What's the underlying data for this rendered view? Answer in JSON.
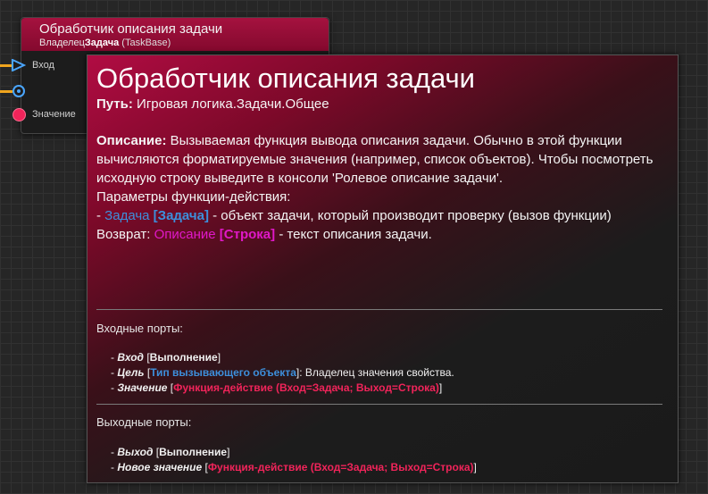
{
  "node": {
    "title": "Обработчик описания задачи",
    "subtitle_prefix": "Владелец",
    "subtitle_bold": "Задача",
    "subtitle_suffix": "(TaskBase)",
    "ports": {
      "exec_in_label": "Вход",
      "value_label": "Значение"
    },
    "colors": {
      "header": "#a5123f",
      "exec_pin": "#4aa6ff",
      "wire": "#f0a51e",
      "value_pin": "#f0245a"
    }
  },
  "tooltip": {
    "title": "Обработчик описания задачи",
    "path_label": "Путь:",
    "path_value": "Игровая логика.Задачи.Общее",
    "description_label": "Описание:",
    "description_text": "Вызываемая функция вывода описания задачи. Обычно в этой функции вычисляются форматируемые значения (например, список объектов). Чтобы посмотреть исходную строку выведите в консоли 'Ролевое описание задачи'.",
    "params_header": "Параметры функции-действия:",
    "param": {
      "dash": "- ",
      "name": "Задача",
      "type": "[Задача]",
      "text": "- объект задачи, который производит проверку (вызов функции)"
    },
    "return": {
      "label": "Возврат:",
      "name": "Описание",
      "type": "[Строка]",
      "text": "- текст описания задачи."
    },
    "input_ports_header": "Входные порты:",
    "input_ports": [
      {
        "name": "Вход",
        "type": "Выполнение",
        "note": ""
      },
      {
        "name": "Цель",
        "type": "Тип вызывающего объекта",
        "note": ": Владелец значения свойства."
      },
      {
        "name": "Значение",
        "type": "Функция-действие (Вход=Задача; Выход=Строка)",
        "note": ""
      }
    ],
    "output_ports_header": "Выходные порты:",
    "output_ports": [
      {
        "name": "Выход",
        "type": "Выполнение"
      },
      {
        "name": "Новое значение",
        "type": "Функция-действие (Вход=Задача; Выход=Строка)"
      }
    ]
  }
}
